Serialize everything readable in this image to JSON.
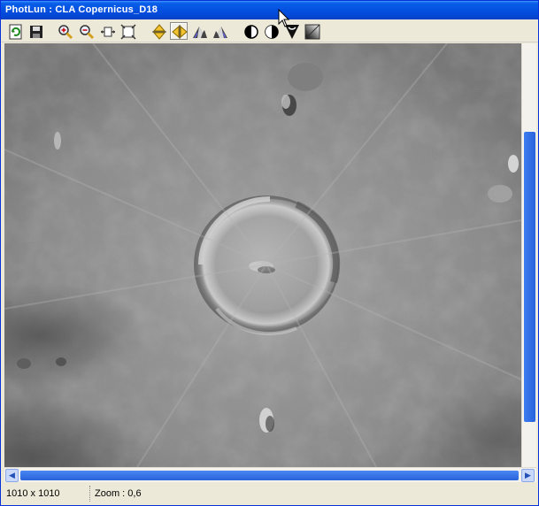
{
  "window": {
    "title": "PhotLun : CLA  Copernicus_D18"
  },
  "toolbar": {
    "buttons": [
      {
        "name": "refresh-button",
        "icon": "refresh-icon"
      },
      {
        "name": "save-button",
        "icon": "floppy-disk-icon"
      },
      {
        "name": "zoom-in-button",
        "icon": "zoom-in-icon"
      },
      {
        "name": "zoom-out-button",
        "icon": "zoom-out-icon"
      },
      {
        "name": "fit-width-button",
        "icon": "fit-width-icon"
      },
      {
        "name": "fit-page-button",
        "icon": "fit-page-icon"
      },
      {
        "name": "flip-vertical-button",
        "icon": "flip-vertical-icon"
      },
      {
        "name": "flip-horizontal-button",
        "icon": "flip-horizontal-icon"
      },
      {
        "name": "rotate-left-button",
        "icon": "mountain-left-icon"
      },
      {
        "name": "rotate-right-button",
        "icon": "mountain-right-icon"
      },
      {
        "name": "contrast-button",
        "icon": "contrast-icon"
      },
      {
        "name": "invert-button",
        "icon": "invert-icon"
      },
      {
        "name": "gamma-button",
        "icon": "gamma-icon"
      },
      {
        "name": "gradient-button",
        "icon": "gradient-icon"
      }
    ]
  },
  "status": {
    "dimensions": "1010 x 1010",
    "zoom": "Zoom : 0,6"
  }
}
